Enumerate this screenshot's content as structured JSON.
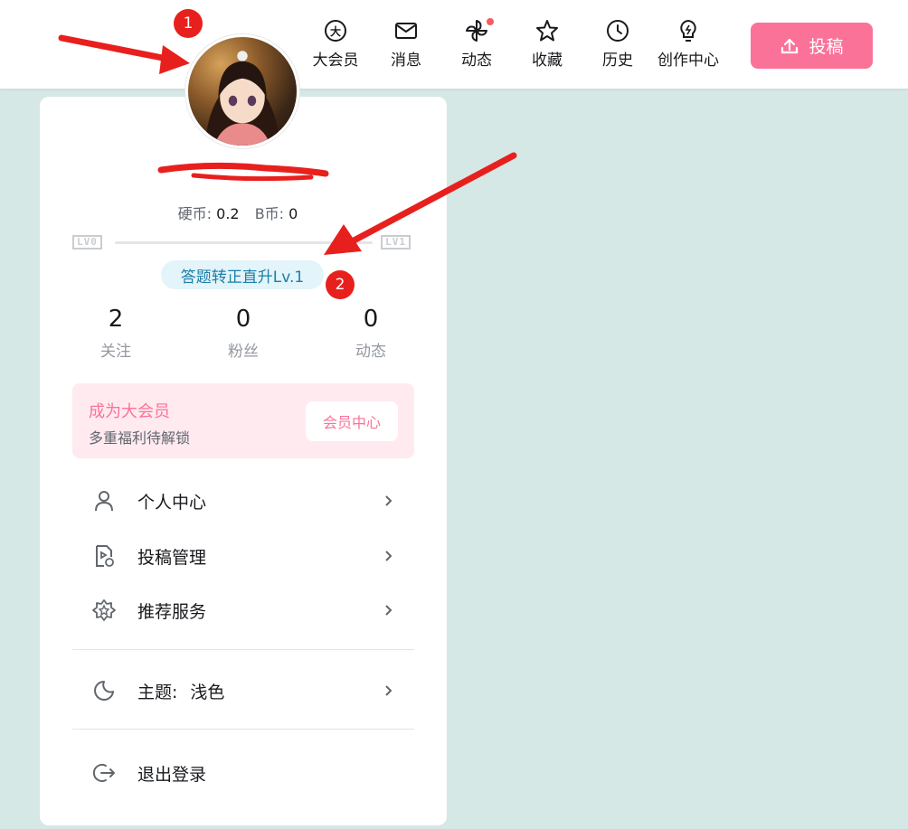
{
  "header": {
    "nav": [
      {
        "name": "nav-vip",
        "icon": "big-member-icon",
        "label": "大会员"
      },
      {
        "name": "nav-messages",
        "icon": "mail-icon",
        "label": "消息"
      },
      {
        "name": "nav-dynamic",
        "icon": "pinwheel-icon",
        "label": "动态",
        "has_dot": true
      },
      {
        "name": "nav-favorites",
        "icon": "star-icon",
        "label": "收藏"
      },
      {
        "name": "nav-history",
        "icon": "clock-icon",
        "label": "历史"
      },
      {
        "name": "nav-creator",
        "icon": "lightbulb-icon",
        "label": "创作中心"
      }
    ],
    "upload_label": "投稿",
    "accent": "#fb7299"
  },
  "profile": {
    "coins_label": "硬币:",
    "coins_value": "0.2",
    "bcoin_label": "B币:",
    "bcoin_value": "0",
    "level_from": "LV0",
    "level_to": "LV1",
    "level_progress": 0,
    "answer_label": "答题转正直升Lv.1"
  },
  "stats": [
    {
      "value": "2",
      "label": "关注"
    },
    {
      "value": "0",
      "label": "粉丝"
    },
    {
      "value": "0",
      "label": "动态"
    }
  ],
  "vip": {
    "title": "成为大会员",
    "subtitle": "多重福利待解锁",
    "button": "会员中心"
  },
  "menu": {
    "personal": "个人中心",
    "manage": "投稿管理",
    "recommend": "推荐服务",
    "theme_label": "主题:",
    "theme_value": "浅色",
    "logout": "退出登录"
  },
  "annotations": {
    "one": "1",
    "two": "2",
    "color": "#e8201d"
  }
}
